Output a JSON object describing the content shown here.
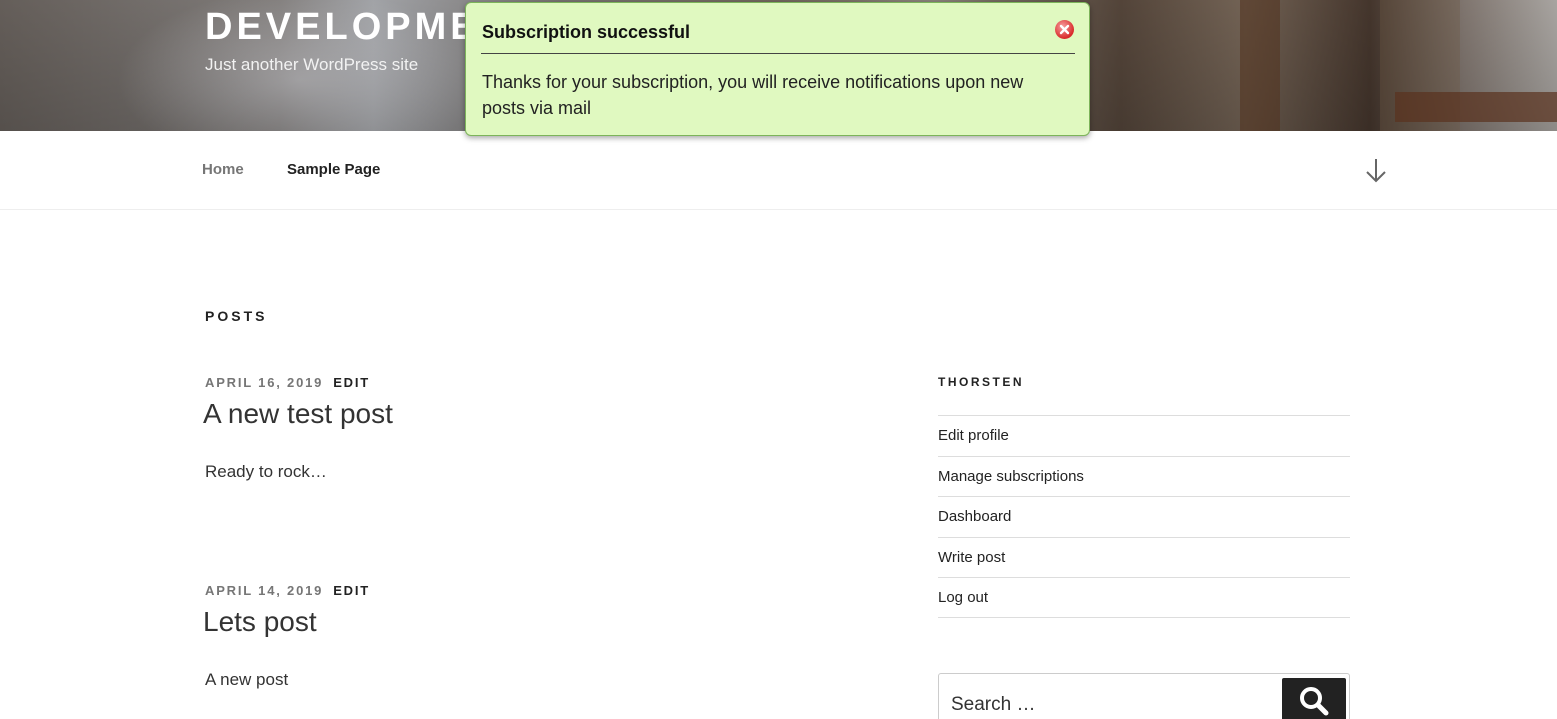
{
  "header": {
    "site_title": "DEVELOPMENT",
    "tagline": "Just another WordPress site"
  },
  "notification": {
    "title": "Subscription successful",
    "message": "Thanks for your subscription, you will receive notifications upon new posts via mail",
    "close_icon": "close-icon",
    "accent": "#e0f9c0"
  },
  "nav": {
    "items": [
      {
        "label": "Home"
      },
      {
        "label": "Sample Page"
      }
    ],
    "scroll_icon": "arrow-down-icon"
  },
  "main": {
    "section_title": "POSTS",
    "posts": [
      {
        "date": "APRIL 16, 2019",
        "edit": "EDIT",
        "title": "A new test post",
        "excerpt": "Ready to rock…"
      },
      {
        "date": "APRIL 14, 2019",
        "edit": "EDIT",
        "title": "Lets post",
        "excerpt": "A new post"
      }
    ]
  },
  "sidebar": {
    "widget_title": "THORSTEN",
    "links": [
      {
        "label": "Edit profile"
      },
      {
        "label": "Manage subscriptions"
      },
      {
        "label": "Dashboard"
      },
      {
        "label": "Write post"
      },
      {
        "label": "Log out"
      }
    ],
    "search": {
      "placeholder": "Search …",
      "icon": "search-icon"
    }
  }
}
